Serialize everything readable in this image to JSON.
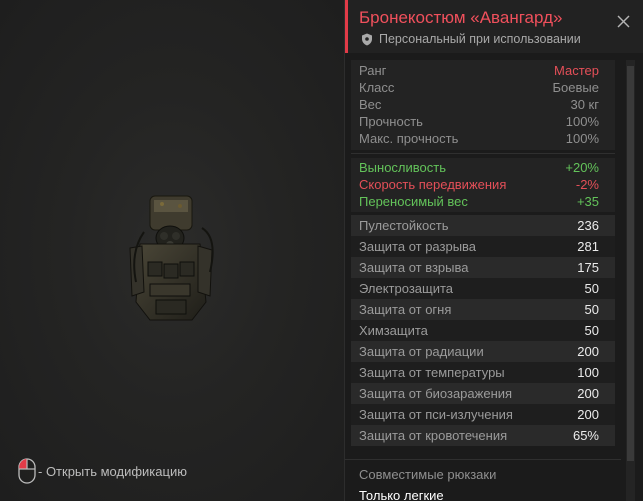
{
  "item": {
    "title": "Бронекостюм «Авангард»",
    "subtitle": "Персональный при использовании"
  },
  "base_stats": [
    {
      "label": "Ранг",
      "value": "Мастер",
      "value_color": "#f0505c"
    },
    {
      "label": "Класс",
      "value": "Боевые"
    },
    {
      "label": "Вес",
      "value": "30 кг"
    },
    {
      "label": "Прочность",
      "value": "100%"
    },
    {
      "label": "Макс. прочность",
      "value": "100%"
    }
  ],
  "modifiers": [
    {
      "label": "Выносливость",
      "value": "+20%",
      "tone": "positive"
    },
    {
      "label": "Скорость передвижения",
      "value": "-2%",
      "tone": "negative"
    },
    {
      "label": "Переносимый вес",
      "value": "+35",
      "tone": "positive"
    }
  ],
  "protection": [
    {
      "label": "Пулестойкость",
      "value": "236"
    },
    {
      "label": "Защита от разрыва",
      "value": "281"
    },
    {
      "label": "Защита от взрыва",
      "value": "175"
    },
    {
      "label": "Электрозащита",
      "value": "50"
    },
    {
      "label": "Защита от огня",
      "value": "50"
    },
    {
      "label": "Химзащита",
      "value": "50"
    },
    {
      "label": "Защита от радиации",
      "value": "200"
    },
    {
      "label": "Защита от температуры",
      "value": "100"
    },
    {
      "label": "Защита от биозаражения",
      "value": "200"
    },
    {
      "label": "Защита от пси-излучения",
      "value": "200"
    },
    {
      "label": "Защита от кровотечения",
      "value": "65%"
    }
  ],
  "compat": {
    "label": "Совместимые рюкзаки",
    "value": "Только легкие"
  },
  "hint": {
    "text": "- Открыть модификацию",
    "icon": "mouse-icon"
  },
  "colors": {
    "accent": "#e23b48",
    "positive": "#63c35a",
    "negative": "#e44f58"
  }
}
